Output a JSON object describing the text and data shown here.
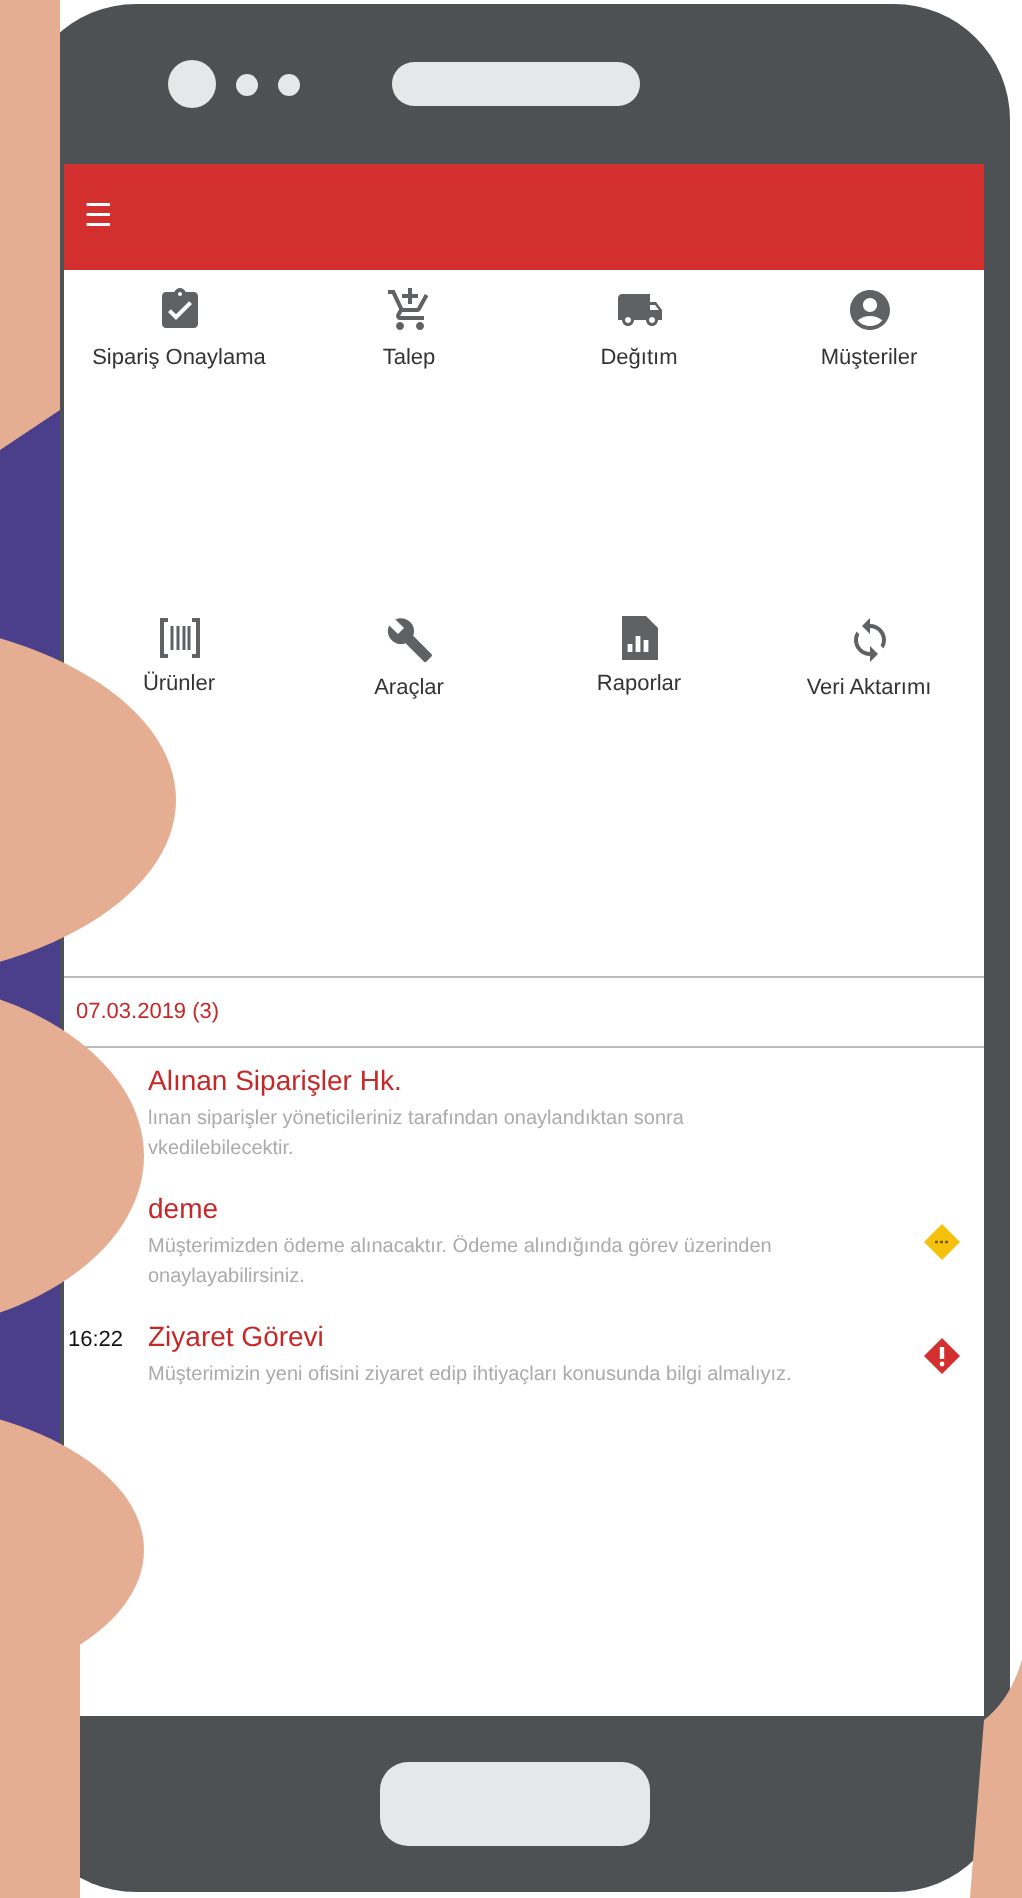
{
  "app_bar": {
    "menu_icon": "☰"
  },
  "shortcuts": [
    {
      "label": "Sipariş Onaylama",
      "kind": "approve"
    },
    {
      "label": "Talep",
      "kind": "cart"
    },
    {
      "label": "Değıtım",
      "kind": "truck"
    },
    {
      "label": "Müşteriler",
      "kind": "person"
    },
    {
      "label": "Ürünler",
      "kind": "barcode"
    },
    {
      "label": "Araçlar",
      "kind": "wrench"
    },
    {
      "label": "Raporlar",
      "kind": "report"
    },
    {
      "label": "Veri Aktarımı",
      "kind": "sync"
    }
  ],
  "date_header": "07.03.2019 (3)",
  "tasks": [
    {
      "title": "Alınan Siparişler Hk.",
      "body": "lınan siparişler yöneticileriniz tarafından onaylandıktan sonra vkedilebilecektir.",
      "kind": "plain"
    },
    {
      "title": "deme",
      "body": "Müşterimizden ödeme alınacaktır. Ödeme alındığında görev üzerinden onaylayabilirsiniz.",
      "kind": "pending"
    },
    {
      "time": "16:22",
      "title": "Ziyaret Görevi",
      "body": "Müşterimizin yeni ofisini ziyaret edip ihtiyaçları konusunda bilgi almalıyız.",
      "kind": "alert"
    }
  ]
}
